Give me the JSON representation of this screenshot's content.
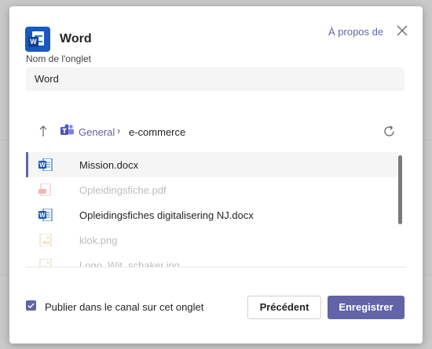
{
  "app": {
    "title": "Word",
    "icon": "word-app-icon",
    "icon_letter": "W"
  },
  "header": {
    "about_label": "À propos de",
    "close_icon": "close-icon"
  },
  "tab_name": {
    "label": "Nom de l'onglet",
    "value": "Word"
  },
  "breadcrumb": {
    "up_icon": "arrow-up-icon",
    "teams_icon": "teams-icon",
    "items": [
      "General",
      "e-commerce"
    ],
    "separator": "›",
    "refresh_icon": "refresh-icon"
  },
  "files": [
    {
      "name": "Mission.docx",
      "icon": "word-file-icon",
      "selected": true,
      "enabled": true
    },
    {
      "name": "Opleidingsfiche.pdf",
      "icon": "pdf-file-icon",
      "selected": false,
      "enabled": false
    },
    {
      "name": "Opleidingsfiches digitalisering NJ.docx",
      "icon": "word-file-icon",
      "selected": false,
      "enabled": true
    },
    {
      "name": "klok.png",
      "icon": "image-file-icon",
      "selected": false,
      "enabled": false
    },
    {
      "name": "Logo_Wit_schaker.jpg",
      "icon": "image-file-icon",
      "selected": false,
      "enabled": false
    }
  ],
  "footer": {
    "post_checkbox_label": "Publier dans le canal sur cet onglet",
    "post_checked": true,
    "back_label": "Précédent",
    "save_label": "Enregistrer"
  },
  "colors": {
    "accent": "#6264a7",
    "word_blue": "#185abd",
    "pdf_red": "#d13438"
  }
}
